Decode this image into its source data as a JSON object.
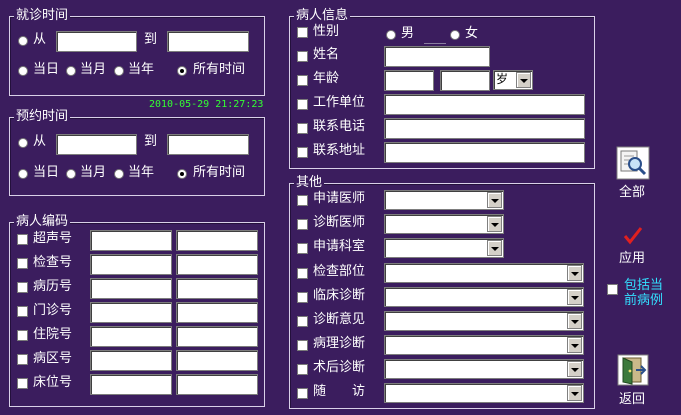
{
  "visit_time": {
    "title": "就诊时间",
    "from_label": "从",
    "to_label": "到",
    "from_value": "",
    "to_value": "",
    "options": [
      {
        "label": "当日",
        "selected": false
      },
      {
        "label": "当月",
        "selected": false
      },
      {
        "label": "当年",
        "selected": false
      },
      {
        "label": "所有时间",
        "selected": true
      }
    ]
  },
  "clock": "2010-05-29 21:27:23",
  "appointment_time": {
    "title": "预约时间",
    "from_label": "从",
    "to_label": "到",
    "options": [
      {
        "label": "当日",
        "selected": false
      },
      {
        "label": "当月",
        "selected": false
      },
      {
        "label": "当年",
        "selected": false
      },
      {
        "label": "所有时间",
        "selected": true
      }
    ]
  },
  "patient_code": {
    "title": "病人编码",
    "rows": [
      "超声号",
      "检查号",
      "病历号",
      "门诊号",
      "住院号",
      "病区号",
      "床位号"
    ]
  },
  "patient_info": {
    "title": "病人信息",
    "gender_label": "性别",
    "male": "男",
    "female": "女",
    "name_label": "姓名",
    "age_label": "年龄",
    "age_unit": "岁",
    "work_label": "工作单位",
    "phone_label": "联系电话",
    "address_label": "联系地址"
  },
  "other": {
    "title": "其他",
    "rows": [
      "申请医师",
      "诊断医师",
      "申请科室",
      "检查部位",
      "临床诊断",
      "诊断意见",
      "病理诊断",
      "术后诊断",
      "随　　访"
    ]
  },
  "actions": {
    "all_label": "全部",
    "apply_label": "应用",
    "include_label_1": "包括当",
    "include_label_2": "前病例",
    "back_label": "返回"
  },
  "colors": {
    "background": "#3b1d5e",
    "clock": "#33ff33",
    "include_text": "#33e0ff",
    "apply_check": "#e02020"
  }
}
